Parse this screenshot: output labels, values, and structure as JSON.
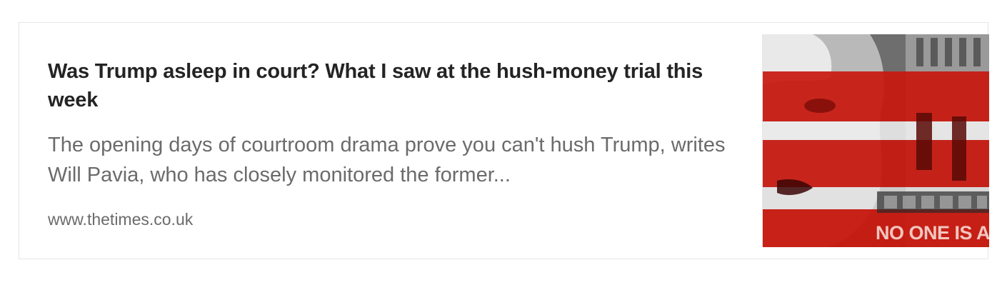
{
  "card": {
    "title": "Was Trump asleep in court? What I saw at the hush-money trial this week",
    "description": "The opening days of courtroom drama prove you can't hush Trump, writes Will Pavia, who has closely monitored the former...",
    "domain": "www.thetimes.co.uk",
    "thumbnail": {
      "icon": "article-thumbnail-image",
      "overlay_text": "NO ONE IS ABO",
      "colors": {
        "red": "#c8180e",
        "dark_red": "#8e0b06",
        "white_stripe": "#f2f2f2",
        "gray": "#8a8a8a"
      }
    }
  }
}
